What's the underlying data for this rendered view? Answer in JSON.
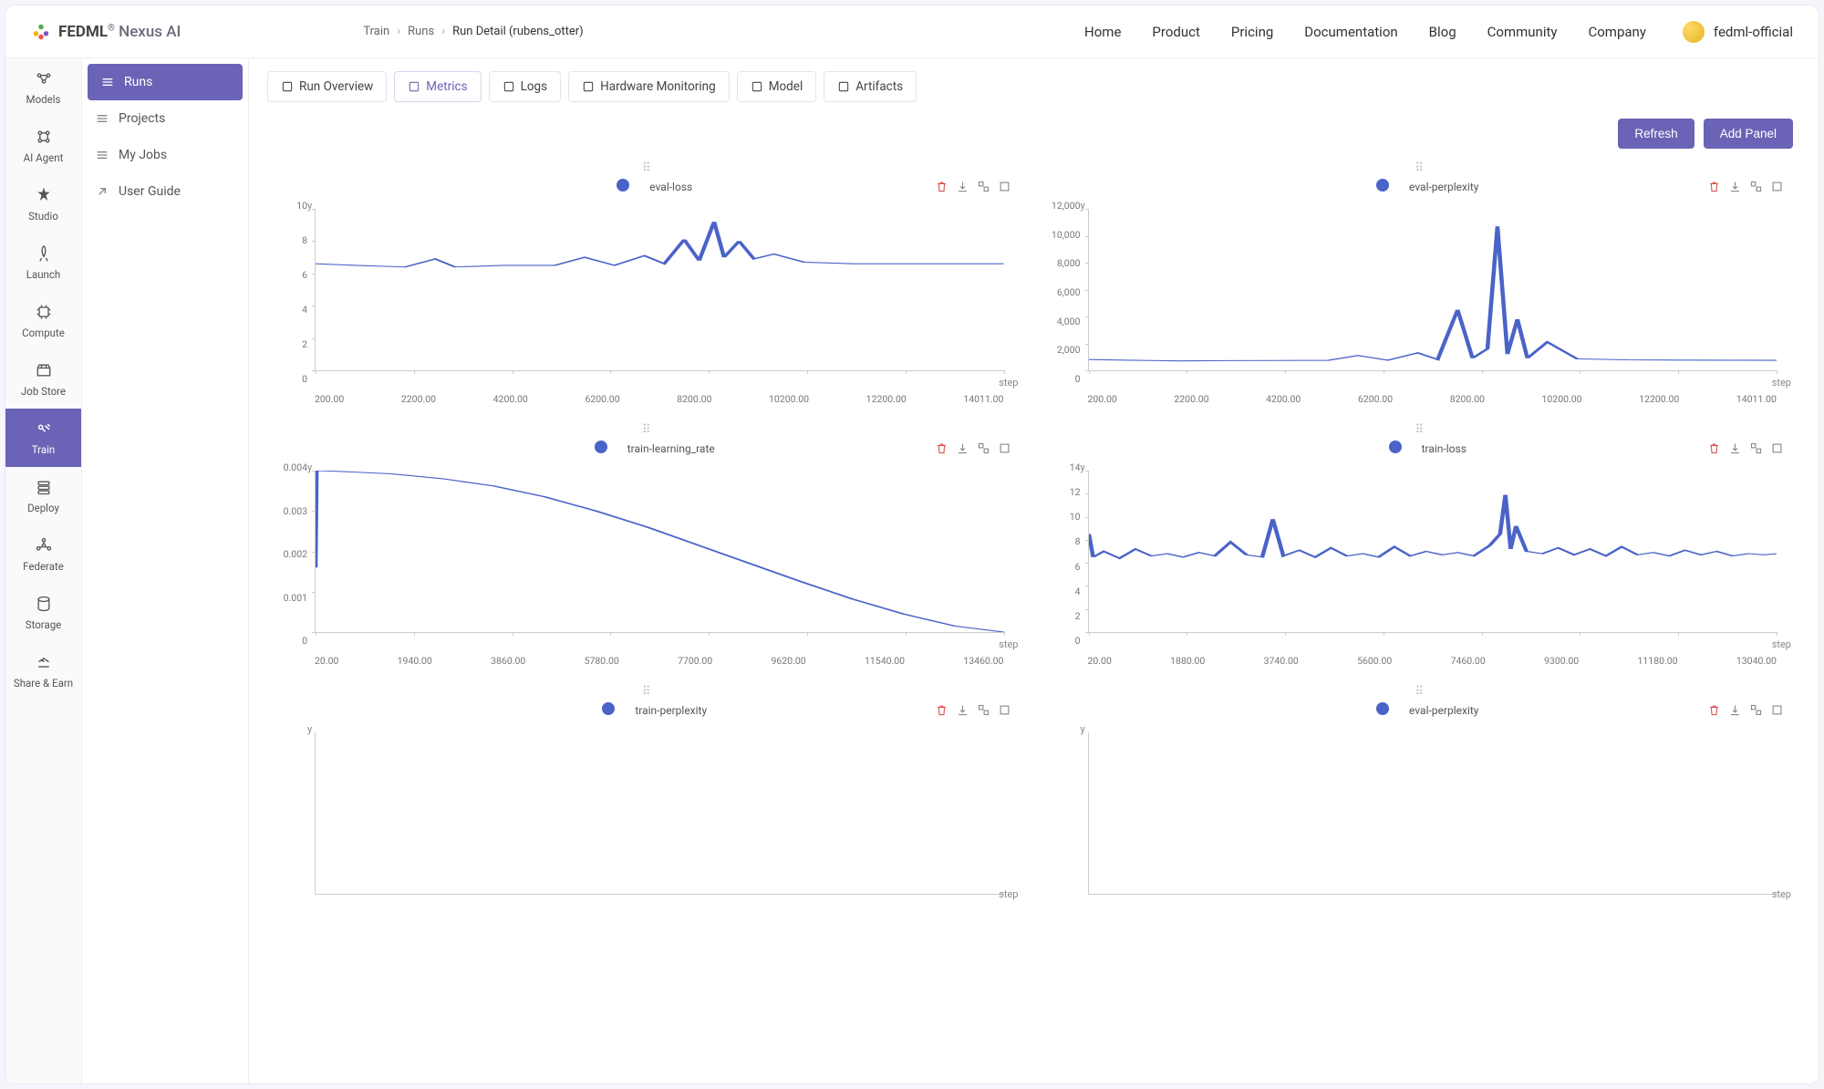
{
  "brand": {
    "name": "FEDML",
    "suffix": "Nexus AI",
    "reg": "®"
  },
  "breadcrumb": [
    "Train",
    "Runs",
    "Run Detail (rubens_otter)"
  ],
  "nav": [
    "Home",
    "Product",
    "Pricing",
    "Documentation",
    "Blog",
    "Community",
    "Company"
  ],
  "user": "fedml-official",
  "rail": [
    {
      "label": "Models",
      "icon": "models"
    },
    {
      "label": "AI Agent",
      "icon": "agent"
    },
    {
      "label": "Studio",
      "icon": "studio"
    },
    {
      "label": "Launch",
      "icon": "launch"
    },
    {
      "label": "Compute",
      "icon": "compute"
    },
    {
      "label": "Job Store",
      "icon": "jobstore"
    },
    {
      "label": "Train",
      "icon": "train",
      "active": true
    },
    {
      "label": "Deploy",
      "icon": "deploy"
    },
    {
      "label": "Federate",
      "icon": "federate"
    },
    {
      "label": "Storage",
      "icon": "storage"
    },
    {
      "label": "Share & Earn",
      "icon": "share"
    }
  ],
  "subnav": [
    {
      "label": "Runs",
      "active": true
    },
    {
      "label": "Projects"
    },
    {
      "label": "My Jobs"
    },
    {
      "label": "User Guide"
    }
  ],
  "tabs": [
    {
      "label": "Run Overview"
    },
    {
      "label": "Metrics",
      "active": true
    },
    {
      "label": "Logs"
    },
    {
      "label": "Hardware Monitoring"
    },
    {
      "label": "Model"
    },
    {
      "label": "Artifacts"
    }
  ],
  "buttons": {
    "refresh": "Refresh",
    "addPanel": "Add Panel"
  },
  "axis": {
    "y": "y",
    "x": "step"
  },
  "chart_data": [
    {
      "type": "line",
      "title": "eval-loss",
      "xlabel": "step",
      "ylabel": "y",
      "xlim": [
        200,
        14011
      ],
      "ylim": [
        0,
        10
      ],
      "xticks": [
        "200.00",
        "2200.00",
        "4200.00",
        "6200.00",
        "8200.00",
        "10200.00",
        "12200.00",
        "14011.00"
      ],
      "yticks": [
        "10",
        "8",
        "6",
        "4",
        "2",
        "0"
      ],
      "x": [
        200,
        1000,
        2000,
        2600,
        3000,
        4000,
        5000,
        5600,
        6200,
        6800,
        7200,
        7600,
        7900,
        8200,
        8400,
        8700,
        9000,
        9400,
        10000,
        11000,
        12000,
        13000,
        14011
      ],
      "values": [
        6.6,
        6.5,
        6.4,
        6.9,
        6.4,
        6.5,
        6.5,
        7.0,
        6.5,
        7.1,
        6.6,
        8.1,
        6.8,
        9.2,
        7.0,
        8.0,
        6.9,
        7.2,
        6.7,
        6.6,
        6.6,
        6.6,
        6.6
      ]
    },
    {
      "type": "line",
      "title": "eval-perplexity",
      "xlabel": "step",
      "ylabel": "y",
      "xlim": [
        200,
        14011
      ],
      "ylim": [
        0,
        12000
      ],
      "xticks": [
        "200.00",
        "2200.00",
        "4200.00",
        "6200.00",
        "8200.00",
        "10200.00",
        "12200.00",
        "14011.00"
      ],
      "yticks": [
        "12,000",
        "10,000",
        "8,000",
        "6,000",
        "4,000",
        "2,000",
        "0"
      ],
      "x": [
        200,
        1000,
        2000,
        3000,
        4000,
        5000,
        5600,
        6200,
        6800,
        7200,
        7600,
        7900,
        8200,
        8400,
        8600,
        8800,
        9000,
        9400,
        10000,
        11000,
        12000,
        13000,
        14011
      ],
      "values": [
        800,
        750,
        700,
        720,
        730,
        740,
        1100,
        750,
        1300,
        800,
        4500,
        900,
        1600,
        10700,
        1200,
        3800,
        900,
        2100,
        850,
        780,
        760,
        750,
        740
      ]
    },
    {
      "type": "line",
      "title": "train-learning_rate",
      "xlabel": "step",
      "ylabel": "y",
      "xlim": [
        20,
        13460
      ],
      "ylim": [
        0,
        0.004
      ],
      "xticks": [
        "20.00",
        "1940.00",
        "3860.00",
        "5780.00",
        "7700.00",
        "9620.00",
        "11540.00",
        "13460.00"
      ],
      "yticks": [
        "0.004",
        "0.003",
        "0.002",
        "0.001",
        "0"
      ],
      "x": [
        20,
        40,
        500,
        1500,
        2500,
        3500,
        4500,
        5500,
        6500,
        7500,
        8500,
        9500,
        10500,
        11500,
        12500,
        13460
      ],
      "values": [
        0.0016,
        0.004,
        0.00398,
        0.00392,
        0.0038,
        0.00362,
        0.00335,
        0.003,
        0.0026,
        0.00215,
        0.0017,
        0.00125,
        0.00082,
        0.00045,
        0.00015,
        0
      ]
    },
    {
      "type": "line",
      "title": "train-loss",
      "xlabel": "step",
      "ylabel": "y",
      "xlim": [
        20,
        13040
      ],
      "ylim": [
        0,
        14
      ],
      "xticks": [
        "20.00",
        "1880.00",
        "3740.00",
        "5600.00",
        "7460.00",
        "9300.00",
        "11180.00",
        "13040.00"
      ],
      "yticks": [
        "14",
        "12",
        "10",
        "8",
        "6",
        "4",
        "2",
        "0"
      ],
      "x": [
        20,
        100,
        300,
        600,
        900,
        1200,
        1500,
        1800,
        2100,
        2400,
        2700,
        3000,
        3300,
        3500,
        3700,
        4000,
        4300,
        4600,
        4900,
        5200,
        5500,
        5800,
        6100,
        6400,
        6700,
        7000,
        7300,
        7600,
        7800,
        7900,
        8000,
        8100,
        8300,
        8600,
        8900,
        9200,
        9500,
        9800,
        10100,
        10400,
        10700,
        11000,
        11300,
        11600,
        11900,
        12200,
        12500,
        12800,
        13040
      ],
      "values": [
        8.5,
        6.5,
        7.0,
        6.4,
        7.2,
        6.6,
        6.8,
        6.5,
        6.9,
        6.6,
        7.8,
        6.7,
        6.5,
        9.8,
        6.6,
        7.1,
        6.5,
        7.3,
        6.6,
        6.8,
        6.5,
        7.4,
        6.6,
        7.0,
        6.7,
        6.9,
        6.6,
        7.5,
        8.5,
        11.9,
        7.2,
        9.2,
        7.0,
        6.8,
        7.3,
        6.7,
        7.2,
        6.6,
        7.4,
        6.7,
        6.9,
        6.6,
        7.1,
        6.7,
        7.0,
        6.6,
        6.8,
        6.7,
        6.8
      ]
    },
    {
      "type": "line",
      "title": "train-perplexity",
      "xlabel": "step",
      "ylabel": "y",
      "xlim": [
        0,
        1
      ],
      "ylim": [
        0,
        1
      ],
      "xticks": [],
      "yticks": [],
      "x": [],
      "values": []
    },
    {
      "type": "line",
      "title": "eval-perplexity",
      "xlabel": "step",
      "ylabel": "y",
      "xlim": [
        0,
        1
      ],
      "ylim": [
        0,
        1
      ],
      "xticks": [],
      "yticks": [],
      "x": [],
      "values": []
    }
  ]
}
